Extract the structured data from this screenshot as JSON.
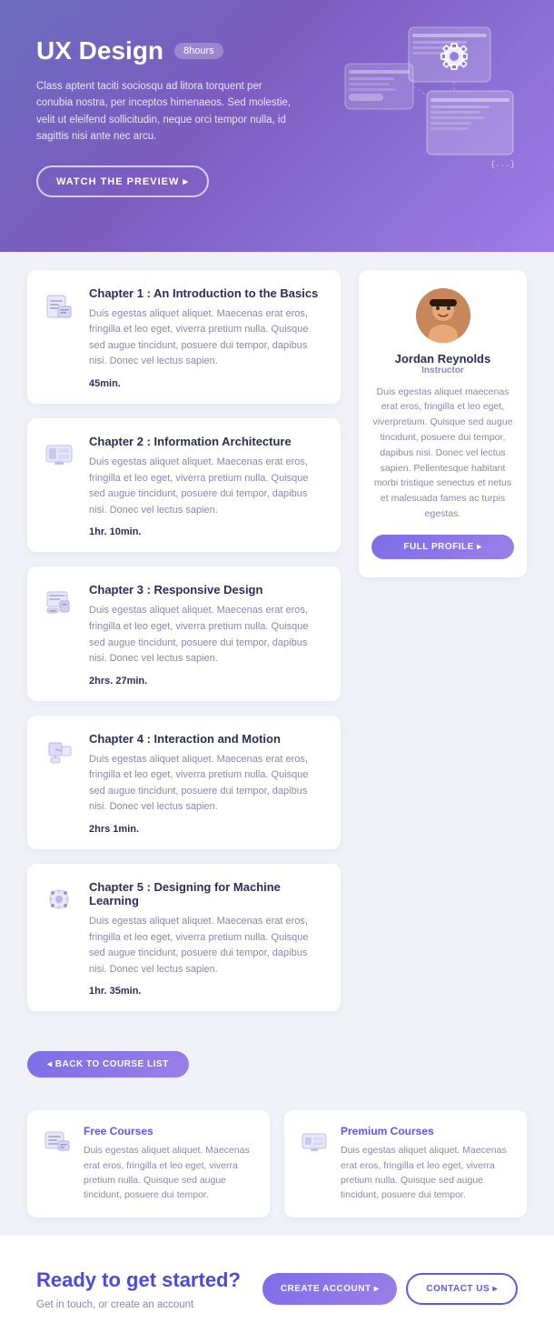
{
  "hero": {
    "title": "UX Design",
    "badge": "8hours",
    "description": "Class aptent taciti sociosqu ad litora torquent per conubia nostra, per inceptos himenaeos. Sed molestie, velit ut eleifend sollicitudin, neque orci tempor nulla, id sagittis nisi ante nec arcu.",
    "watch_btn": "WATCH THE PREVIEW ▸"
  },
  "chapters": [
    {
      "title": "Chapter 1 : An Introduction to the Basics",
      "description": "Duis egestas aliquet aliquet. Maecenas erat eros, fringilla et leo eget, viverra pretium nulla. Quisque sed augue tincidunt, posuere dui tempor, dapibus nisi. Donec vel lectus sapien.",
      "duration": "45min."
    },
    {
      "title": "Chapter 2 : Information Architecture",
      "description": "Duis egestas aliquet aliquet. Maecenas erat eros, fringilla et leo eget, viverra pretium nulla. Quisque sed augue tincidunt, posuere dui tempor, dapibus nisi. Donec vel lectus sapien.",
      "duration": "1hr. 10min."
    },
    {
      "title": "Chapter 3 : Responsive Design",
      "description": "Duis egestas aliquet aliquet. Maecenas erat eros, fringilla et leo eget, viverra pretium nulla. Quisque sed augue tincidunt, posuere dui tempor, dapibus nisi. Donec vel lectus sapien.",
      "duration": "2hrs. 27min."
    },
    {
      "title": "Chapter 4 : Interaction and Motion",
      "description": "Duis egestas aliquet aliquet. Maecenas erat eros, fringilla et leo eget, viverra pretium nulla. Quisque sed augue tincidunt, posuere dui tempor, dapibus nisi. Donec vel lectus sapien.",
      "duration": "2hrs 1min."
    },
    {
      "title": "Chapter 5 : Designing for Machine Learning",
      "description": "Duis egestas aliquet aliquet. Maecenas erat eros, fringilla et leo eget, viverra pretium nulla. Quisque sed augue tincidunt, posuere dui tempor, dapibus nisi. Donec vel lectus sapien.",
      "duration": "1hr. 35min."
    }
  ],
  "instructor": {
    "name": "Jordan Reynolds",
    "role": "Instructor",
    "bio": "Duis egestas aliquet maecenas erat eros, fringilla et leo eget, viverpretium. Quisque sed augue tincidunt, posuere dui tempor, dapibus nisi. Donec vel lectus sapien. Pellentesque habitant morbi tristique senectus et netus et malesuada fames ac turpis egestas.",
    "full_profile_btn": "FULL PROFILE ▸"
  },
  "back_btn": "◂ BACK TO COURSE LIST",
  "bottom_cards": [
    {
      "title": "Free Courses",
      "description": "Duis egestas aliquet aliquet. Maecenas erat eros, fringilla et leo eget, viverra pretium nulla. Quisque sed augue tincidunt, posuere dui tempor."
    },
    {
      "title": "Premium Courses",
      "description": "Duis egestas aliquet aliquet. Maecenas erat eros, fringilla et leo eget, viverra pretium nulla. Quisque sed augue tincidunt, posuere dui tempor."
    }
  ],
  "footer": {
    "heading": "Ready to get started?",
    "subtext": "Get in touch, or create an account",
    "create_account_btn": "CREATE ACCOUNT ▸",
    "contact_btn": "CONTACT US ▸"
  }
}
